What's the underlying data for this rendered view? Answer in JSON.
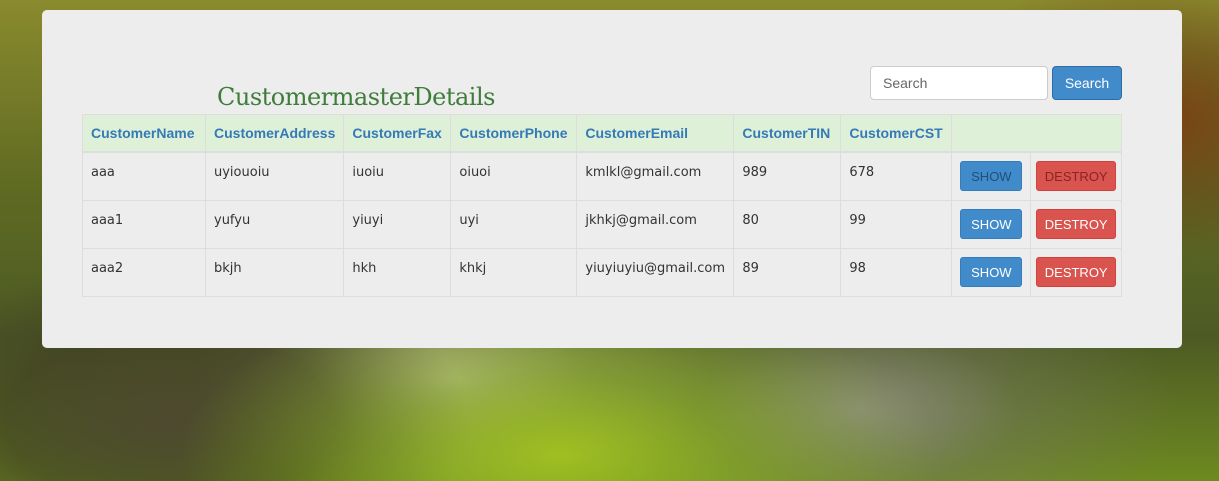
{
  "page": {
    "title": "CustomermasterDetails"
  },
  "search": {
    "placeholder": "Search",
    "button_label": "Search"
  },
  "table": {
    "headers": [
      "CustomerName",
      "CustomerAddress",
      "CustomerFax",
      "CustomerPhone",
      "CustomerEmail",
      "CustomerTIN",
      "CustomerCST",
      ""
    ],
    "rows": [
      {
        "name": "aaa",
        "address": "uyiouoiu",
        "fax": "iuoiu",
        "phone": "oiuoi",
        "email": "kmlkl@gmail.com",
        "tin": "989",
        "cst": "678",
        "show_label": "SHOW",
        "destroy_label": "DESTROY"
      },
      {
        "name": "aaa1",
        "address": "yufyu",
        "fax": "yiuyi",
        "phone": "uyi",
        "email": "jkhkj@gmail.com",
        "tin": "80",
        "cst": "99",
        "show_label": "SHOW",
        "destroy_label": "DESTROY"
      },
      {
        "name": "aaa2",
        "address": "bkjh",
        "fax": "hkh",
        "phone": "khkj",
        "email": "yiuyiuyiu@gmail.com",
        "tin": "89",
        "cst": "98",
        "show_label": "SHOW",
        "destroy_label": "DESTROY"
      }
    ]
  },
  "colors": {
    "title": "#3e7d3a",
    "header_bg": "#dff0d8",
    "header_text": "#337ab7",
    "primary": "#428bca",
    "danger": "#d9534f",
    "card_bg": "#ededed"
  }
}
